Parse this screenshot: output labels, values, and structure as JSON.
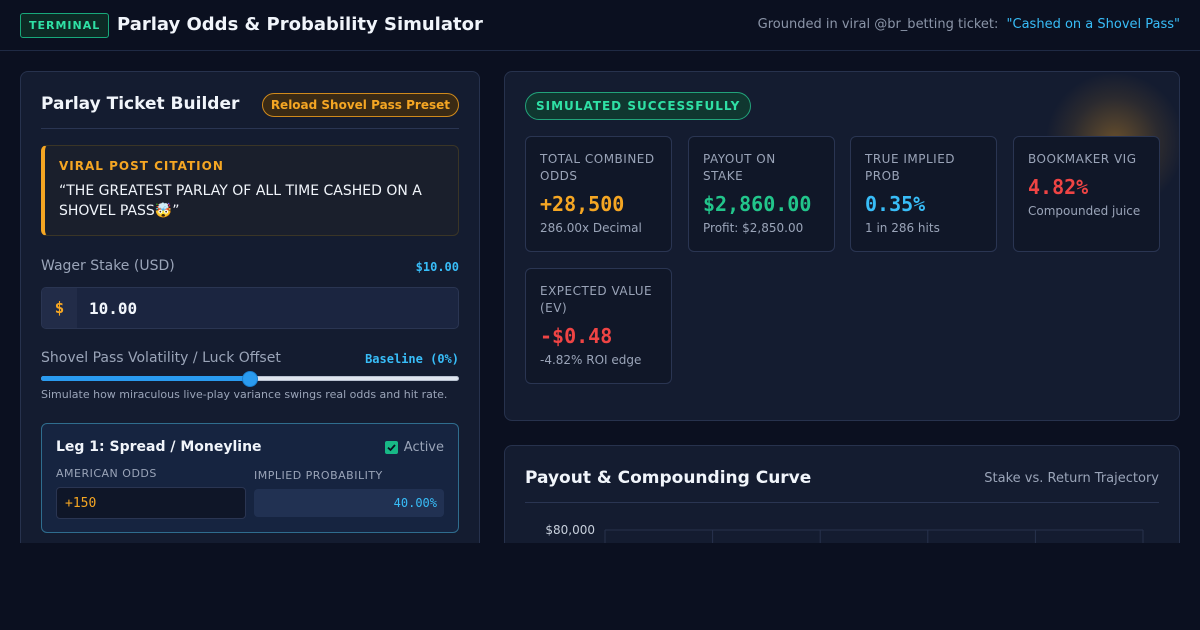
{
  "header": {
    "tag": "TERMINAL",
    "title": "Parlay Odds & Probability Simulator",
    "grounded_prefix": "Grounded in viral @br_betting ticket:",
    "grounded_quote": "\"Cashed on a Shovel Pass\""
  },
  "builder": {
    "title": "Parlay Ticket Builder",
    "preset_button": "Reload Shovel Pass Preset",
    "citation_label": "VIRAL POST CITATION",
    "citation_text": "“THE GREATEST PARLAY OF ALL TIME CASHED ON A SHOVEL PASS🤯”",
    "stake_label": "Wager Stake (USD)",
    "stake_display": "$10.00",
    "stake_prefix": "$",
    "stake_value": "10.00",
    "volatility_label": "Shovel Pass Volatility / Luck Offset",
    "volatility_display": "Baseline (0%)",
    "volatility_fraction": 0.5,
    "volatility_help": "Simulate how miraculous live-play variance swings real odds and hit rate."
  },
  "legs": [
    {
      "title": "Leg 1: Spread / Moneyline",
      "active_label": "Active",
      "active": true,
      "odds_label": "AMERICAN ODDS",
      "odds_value": "+150",
      "prob_label": "IMPLIED PROBABILITY",
      "prob_value": "40.00%"
    }
  ],
  "results": {
    "status": "SIMULATED SUCCESSFULLY",
    "stats": [
      {
        "label": "TOTAL COMBINED ODDS",
        "value": "+28,500",
        "sub": "286.00x Decimal",
        "color": "#f5a623"
      },
      {
        "label": "PAYOUT ON STAKE",
        "value": "$2,860.00",
        "sub": "Profit: $2,850.00",
        "color": "#22c58b"
      },
      {
        "label": "TRUE IMPLIED PROB",
        "value": "0.35%",
        "sub": "1 in 286 hits",
        "color": "#38bdf8"
      },
      {
        "label": "BOOKMAKER VIG",
        "value": "4.82%",
        "sub": "Compounded juice",
        "color": "#ef4444"
      },
      {
        "label": "EXPECTED VALUE (EV)",
        "value": "-$0.48",
        "sub": "-4.82% ROI edge",
        "color": "#ef4444"
      }
    ]
  },
  "chart": {
    "title": "Payout & Compounding Curve",
    "subtitle": "Stake vs. Return Trajectory"
  },
  "chart_data": {
    "type": "line",
    "title": "Payout & Compounding Curve",
    "subtitle": "Stake vs. Return Trajectory",
    "y_tick_labels": [
      "$80,000"
    ],
    "series": []
  }
}
